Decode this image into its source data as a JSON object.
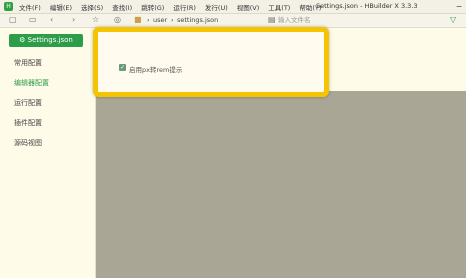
{
  "app": {
    "title": "Settings.json - HBuilder X 3.3.3",
    "menu": [
      "文件(F)",
      "编辑(E)",
      "选择(S)",
      "查找(I)",
      "跳转(G)",
      "运行(R)",
      "发行(U)",
      "视图(V)",
      "工具(T)",
      "帮助(Y)"
    ]
  },
  "toolbar": {
    "breadcrumb": [
      "user",
      "settings.json"
    ],
    "search_placeholder": "输入文件名"
  },
  "sidebar": {
    "settings_button": "Settings.json",
    "items": [
      "常用配置",
      "编辑器配置",
      "运行配置",
      "插件配置",
      "源码视图"
    ],
    "active_index": 1
  },
  "dialog": {
    "checkbox_label": "启用px转rem提示",
    "checkbox_checked": true
  }
}
